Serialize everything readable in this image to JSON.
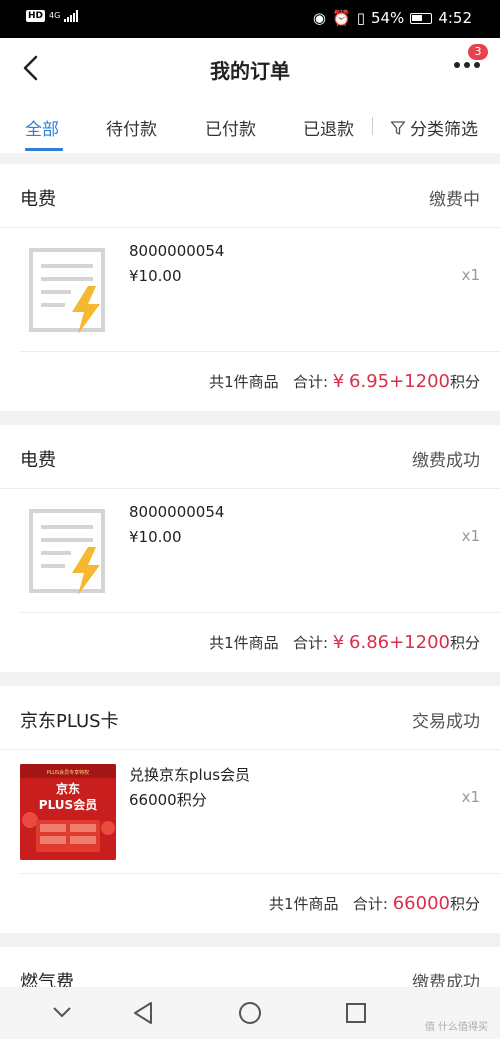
{
  "status_bar": {
    "hd": "HD",
    "network": "4G",
    "battery": "54%",
    "time": "4:52"
  },
  "header": {
    "title": "我的订单",
    "badge": "3"
  },
  "tabs": [
    {
      "label": "全部",
      "active": true
    },
    {
      "label": "待付款",
      "active": false
    },
    {
      "label": "已付款",
      "active": false
    },
    {
      "label": "已退款",
      "active": false
    }
  ],
  "filter_label": "分类筛选",
  "orders": [
    {
      "title": "电费",
      "status": "缴费中",
      "item_name": "8000000054",
      "item_price": "¥10.00",
      "qty": "x1",
      "count_label": "共1件商品",
      "total_label": "合计:",
      "currency": "¥",
      "amount": "6.95+1200",
      "points_suffix": "积分",
      "icon": "electricity-bill-icon"
    },
    {
      "title": "电费",
      "status": "缴费成功",
      "item_name": "8000000054",
      "item_price": "¥10.00",
      "qty": "x1",
      "count_label": "共1件商品",
      "total_label": "合计:",
      "currency": "¥",
      "amount": "6.86+1200",
      "points_suffix": "积分",
      "icon": "electricity-bill-icon"
    },
    {
      "title": "京东PLUS卡",
      "status": "交易成功",
      "item_name": "兑换京东plus会员",
      "item_price": "66000积分",
      "qty": "x1",
      "count_label": "共1件商品",
      "total_label": "合计:",
      "currency": "",
      "amount": "66000",
      "points_suffix": "积分",
      "thumb_lines": [
        "PLUS会员专享特权",
        "京东",
        "PLUS会员"
      ],
      "icon": "jd-plus-card-image"
    },
    {
      "title": "燃气费",
      "status": "缴费成功"
    }
  ],
  "watermark": "值 什么值得买",
  "colors": {
    "accent": "#2f7fd8",
    "price": "#d9304a",
    "badge": "#e8424f",
    "bolt": "#f5b82e"
  }
}
